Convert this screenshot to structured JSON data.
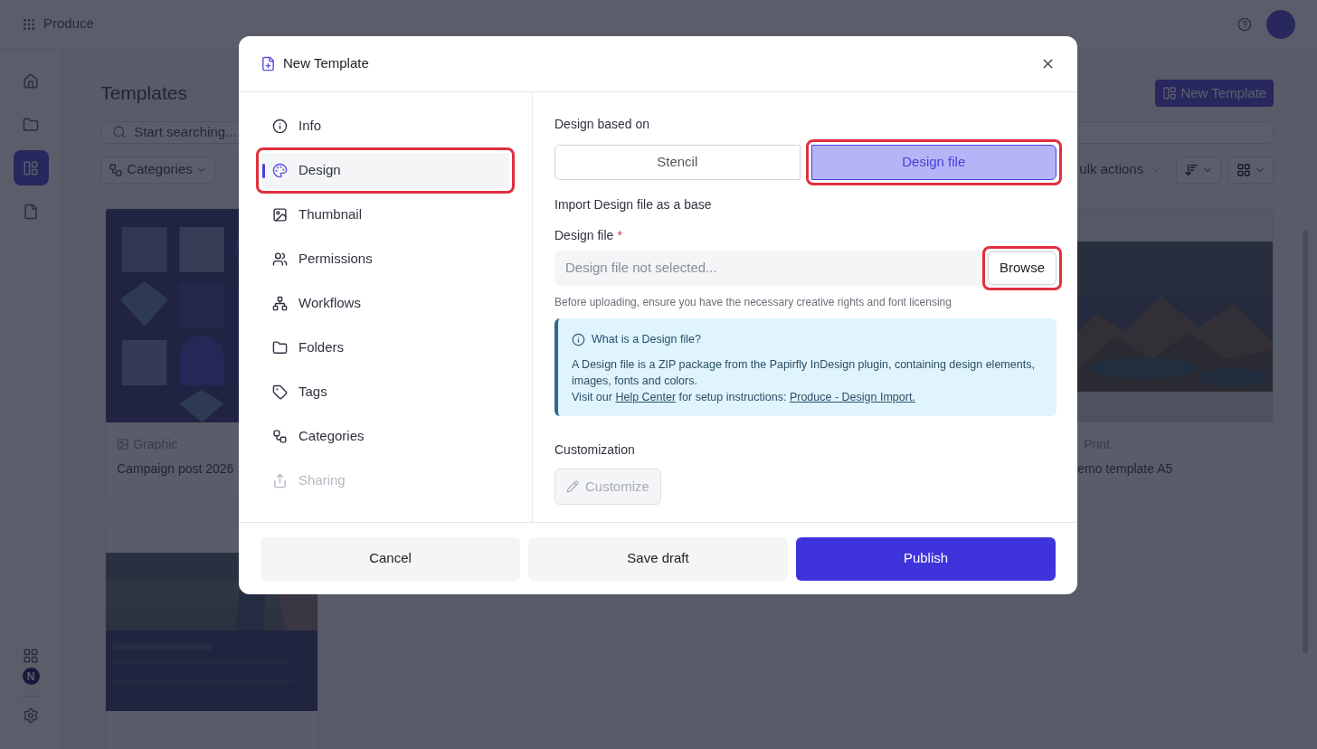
{
  "app": {
    "name": "Produce",
    "page_title": "Templates",
    "search_placeholder": "Start searching...",
    "new_template_button": "New Template",
    "filter_button": "Categories",
    "bulk_actions": "ulk actions",
    "rail": [
      {
        "selected": false
      },
      {
        "selected": false
      },
      {
        "selected": true
      },
      {
        "selected": false
      }
    ],
    "rail_badge": "N",
    "cards": [
      {
        "type": "Graphic",
        "title": "Campaign post 2026"
      },
      {
        "type": "Print",
        "title": "emo template A5"
      },
      {
        "kind": "picture"
      }
    ]
  },
  "dialog": {
    "title": "New Template",
    "nav": [
      {
        "label": "Info",
        "selected": false,
        "disabled": false,
        "highlighted": false
      },
      {
        "label": "Design",
        "selected": true,
        "disabled": false,
        "highlighted": true
      },
      {
        "label": "Thumbnail",
        "selected": false,
        "disabled": false,
        "highlighted": false
      },
      {
        "label": "Permissions",
        "selected": false,
        "disabled": false,
        "highlighted": false
      },
      {
        "label": "Workflows",
        "selected": false,
        "disabled": false,
        "highlighted": false
      },
      {
        "label": "Folders",
        "selected": false,
        "disabled": false,
        "highlighted": false
      },
      {
        "label": "Tags",
        "selected": false,
        "disabled": false,
        "highlighted": false
      },
      {
        "label": "Categories",
        "selected": false,
        "disabled": false,
        "highlighted": false
      },
      {
        "label": "Sharing",
        "selected": false,
        "disabled": true,
        "highlighted": false
      }
    ],
    "based_on_label": "Design based on",
    "based_on_options": [
      {
        "label": "Stencil",
        "selected": false,
        "highlighted": false
      },
      {
        "label": "Design file",
        "selected": true,
        "highlighted": true
      }
    ],
    "import_heading": "Import Design file as a base",
    "file_label": "Design file",
    "required_mark": "*",
    "file_placeholder": "Design file not selected...",
    "browse_button": {
      "label": "Browse",
      "highlighted": true
    },
    "helper_text": "Before uploading, ensure you have the necessary creative rights and font licensing",
    "info": {
      "title": "What is a Design file?",
      "body": "A Design file is a ZIP package from the Papirfly InDesign plugin, containing design elements, images, fonts and colors.",
      "parts": [
        {
          "text": "Visit our ",
          "link": false
        },
        {
          "text": "Help Center",
          "link": true
        },
        {
          "text": " for setup instructions: ",
          "link": false
        },
        {
          "text": "Produce - Design Import.",
          "link": true
        }
      ]
    },
    "customization_label": "Customization",
    "customize_button": {
      "label": "Customize",
      "disabled": true
    },
    "footer": [
      {
        "label": "Cancel",
        "kind": "secondary"
      },
      {
        "label": "Save draft",
        "kind": "secondary"
      },
      {
        "label": "Publish",
        "kind": "primary"
      }
    ]
  }
}
